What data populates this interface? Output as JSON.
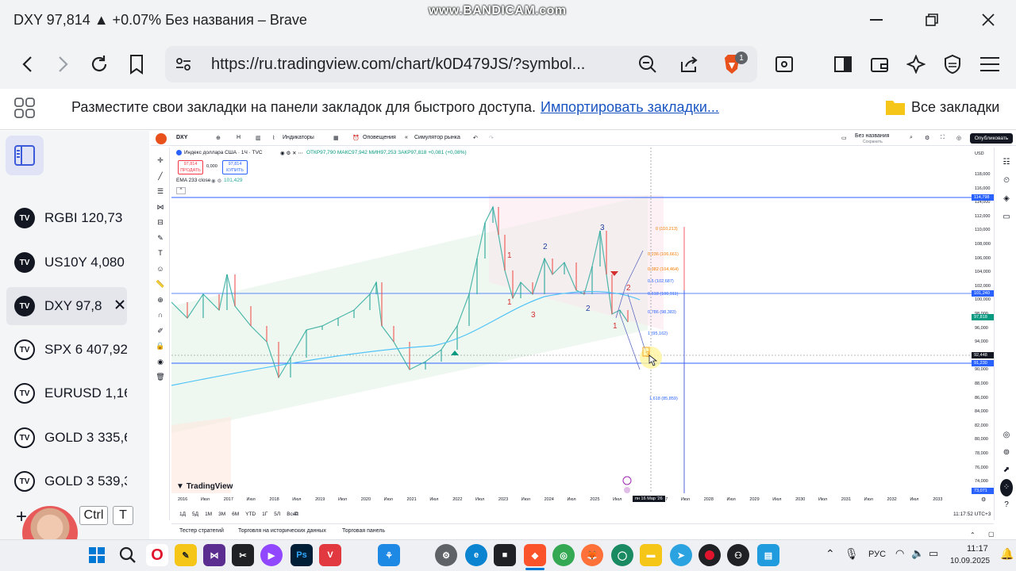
{
  "window": {
    "title": "DXY 97,814 ▲ +0.07% Без названия – Brave",
    "watermark": "www.BANDICAM.com"
  },
  "browser": {
    "url": "https://ru.tradingview.com/chart/k0D479JS/?symbol...",
    "shield_count": "1",
    "bookmarks_text": "Разместите свои закладки на панели закладок для быстрого доступа.",
    "bookmarks_import": "Импортировать закладки...",
    "bookmarks_all": "Все закладки"
  },
  "watchlist": [
    {
      "text": "RGBI 120,73",
      "logo": "TV"
    },
    {
      "text": "US10Y 4,080",
      "logo": "TV"
    },
    {
      "text": "DXY 97,8",
      "logo": "TV"
    },
    {
      "text": "SPX 6 407,92",
      "logo": "TV"
    },
    {
      "text": "EURUSD 1,16",
      "logo": "TV"
    },
    {
      "text": "GOLD 3 335,6",
      "logo": "TV"
    },
    {
      "text": "GOLD 3 539,3",
      "logo": "TV"
    }
  ],
  "sidebar_keys": {
    "ctrl": "Ctrl",
    "t": "T"
  },
  "tv_toolbar": {
    "symbol": "DXY",
    "timeframe": "H",
    "indicators": "Индикаторы",
    "alerts": "Оповещения",
    "replay": "Симулятор рынка",
    "layout_name": "Без названия",
    "saved": "Сохранить",
    "publish": "Опубликовать"
  },
  "legend": {
    "title": "Индекс доллара США · 1Ч · TVC",
    "ohlc": "ОТКР97,790 МАКС97,942 МИН97,253 ЗАКР97,818 +0,081 (+0,08%)",
    "sell_price": "97,814",
    "sell_label": "ПРОДАТЬ",
    "spread": "0,000",
    "buy_price": "97,814",
    "buy_label": "КУПИТЬ",
    "ema": "EMA 233 close",
    "ema_value": "101,429"
  },
  "price_axis": {
    "currency": "USD",
    "labels": [
      "118,000",
      "116,000",
      "114,000",
      "112,000",
      "110,000",
      "108,000",
      "106,000",
      "104,000",
      "102,000",
      "100,000",
      "98,000",
      "96,000",
      "94,000",
      "92,000",
      "90,000",
      "88,000",
      "86,000",
      "84,000",
      "82,000",
      "80,000",
      "78,000",
      "76,000",
      "74,000"
    ],
    "tags": {
      "top": "114,798",
      "ema": "101,240",
      "last": "97,818",
      "cursor": "92,448",
      "line": "91,230",
      "bottom": "73,071"
    }
  },
  "time_axis": {
    "labels": [
      "2016",
      "Июл",
      "2017",
      "Июл",
      "2018",
      "Июл",
      "2019",
      "Июл",
      "2020",
      "Июл",
      "2021",
      "Июл",
      "2022",
      "Июл",
      "2023",
      "Июл",
      "2024",
      "Июл",
      "2025",
      "Июл",
      "2027",
      "Июл",
      "2028",
      "Июл",
      "2029",
      "Июл",
      "2030",
      "Июл",
      "2031",
      "Июл",
      "2032",
      "Июл",
      "2033"
    ],
    "cursor_label": "пн 16 Мар '26"
  },
  "fib_levels": [
    "0 (110,213)",
    "0,236 (106,661)",
    "0,382 (104,464)",
    "0,5 (102,687)",
    "0,618 (100,911)",
    "0,786 (98,383)",
    "1 (95,162)",
    "1,618 (85,859)"
  ],
  "wave_labels": [
    "1",
    "2",
    "1",
    "3",
    "2",
    "3",
    "1",
    "2",
    "3"
  ],
  "brand": "TradingView",
  "ranges": [
    "1Д",
    "5Д",
    "1М",
    "3М",
    "6М",
    "YTD",
    "1Г",
    "5Л",
    "Все"
  ],
  "clock": "11:17:52 UTC+3",
  "bottom_tabs": [
    "Тестер стратегий",
    "Торговля на исторических данных",
    "Торговая панель"
  ],
  "taskbar": {
    "lang": "РУС",
    "time": "11:17",
    "date": "10.09.2025"
  }
}
